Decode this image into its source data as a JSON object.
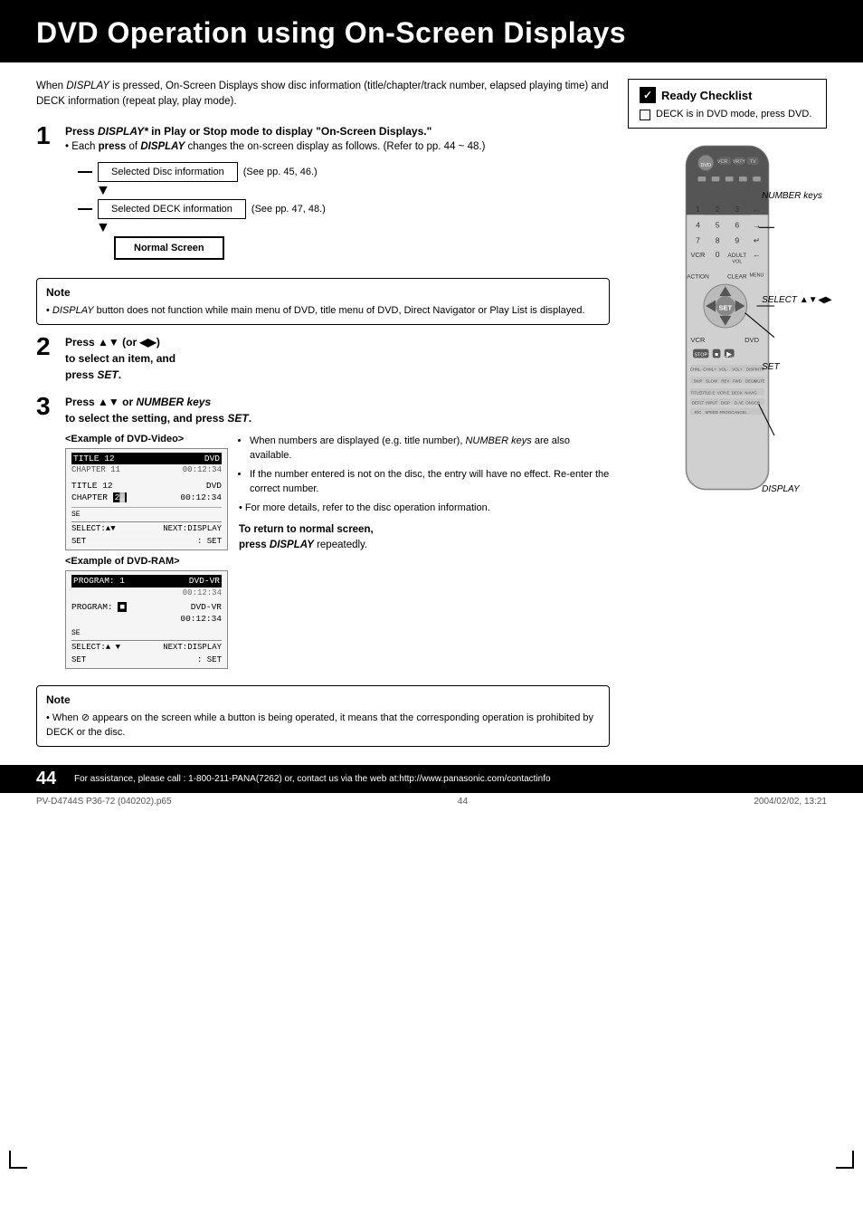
{
  "header": {
    "title": "DVD Operation using On-Screen Displays"
  },
  "intro": {
    "text": "When DISPLAY is pressed, On-Screen Displays show disc information (title/chapter/track number, elapsed playing time) and DECK information (repeat play, play mode)."
  },
  "step1": {
    "number": "1",
    "title_part1": "Press ",
    "title_italic": "DISPLAY*",
    "title_part2": " in Play or Stop mode to display \"On-Screen Displays.\"",
    "bullet": "Each press of DISPLAY changes the on-screen display as follows. (Refer to pp. 44 ~ 48.)"
  },
  "flow": {
    "box1": "Selected Disc information",
    "box1_ref": "(See pp. 45, 46.)",
    "box2": "Selected DECK information",
    "box2_ref": "(See pp. 47, 48.)",
    "box3": "Normal Screen"
  },
  "note1": {
    "title": "Note",
    "text": "DISPLAY button does not function while main menu of DVD, title menu of DVD, Direct Navigator or Play List is displayed."
  },
  "step2": {
    "number": "2",
    "title": "Press ▲▼ (or ◀▶) to select an item, and press SET."
  },
  "step3": {
    "number": "3",
    "title_bold": "Press ▲▼ or NUMBER keys",
    "title_rest": " to select the setting, and press SET.",
    "example_dvd_video_title": "<Example of DVD-Video>",
    "example_dvd_ram_title": "<Example of DVD-RAM>",
    "bullet1": "When numbers are displayed (e.g. title number), NUMBER keys are also available.",
    "bullet2": "If the number entered is not on the disc, the entry will have no effect. Re-enter the correct number.",
    "bullet3": "For more details, refer to the disc operation information.",
    "return_text": "To return to normal screen, press DISPLAY repeatedly."
  },
  "note2": {
    "title": "Note",
    "text": "When ⊘ appears on the screen while a button is being operated, it means that the corresponding operation is prohibited by DECK or the disc."
  },
  "ready_checklist": {
    "title": "Ready Checklist",
    "item": "DECK is in DVD mode, press DVD."
  },
  "remote_labels": {
    "number_keys": "NUMBER keys",
    "select": "SELECT ▲▼◀▶",
    "set": "SET",
    "display": "DISPLAY"
  },
  "page_footer": {
    "number": "44",
    "assistance": "For assistance, please call : 1-800-211-PANA(7262) or, contact us via the web at:http://www.panasonic.com/contactinfo"
  },
  "bottom_info": {
    "left": "PV-D4744S P36-72 (040202).p65",
    "center": "44",
    "right": "2004/02/02, 13:21"
  }
}
